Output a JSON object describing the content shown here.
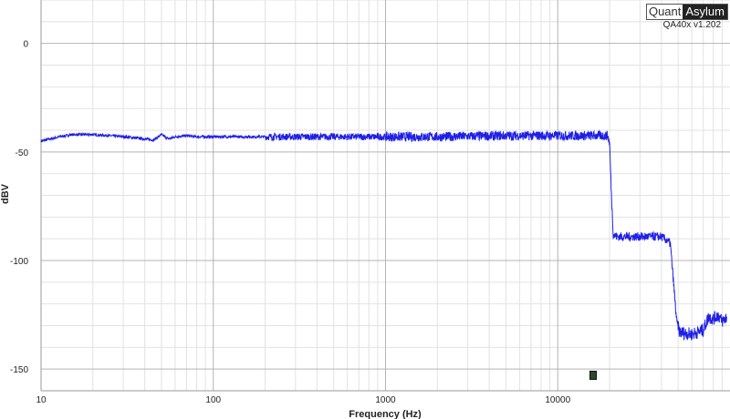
{
  "branding": {
    "logo_part1": "Quant",
    "logo_part2": "Asylum",
    "version": "QA40x v1.202"
  },
  "colors": {
    "trace": "#1f1fe6",
    "grid_major": "#b4b4b4",
    "grid_minor": "#e2e2e2",
    "marker": "#2b4a2b"
  },
  "chart_data": {
    "type": "line",
    "title": "",
    "xlabel": "Frequency (Hz)",
    "ylabel": "dBV",
    "x_scale": "log",
    "xlim": [
      10,
      100000
    ],
    "ylim": [
      -160,
      20
    ],
    "x_ticks": [
      10,
      100,
      1000,
      10000
    ],
    "x_tick_labels": [
      "10",
      "100",
      "1000",
      "10000"
    ],
    "y_ticks": [
      0,
      -50,
      -100,
      -150
    ],
    "y_tick_labels": [
      "0",
      "-50",
      "-100",
      "-150"
    ],
    "grid": true,
    "series": [
      {
        "points": [
          [
            10,
            -45
          ],
          [
            12,
            -43.5
          ],
          [
            15,
            -42
          ],
          [
            20,
            -42
          ],
          [
            25,
            -42.5
          ],
          [
            30,
            -43
          ],
          [
            35,
            -43.5
          ],
          [
            40,
            -44
          ],
          [
            45,
            -44.5
          ],
          [
            50,
            -42
          ],
          [
            55,
            -44
          ],
          [
            60,
            -43
          ],
          [
            70,
            -42.5
          ],
          [
            80,
            -43
          ],
          [
            100,
            -43
          ],
          [
            150,
            -43
          ],
          [
            200,
            -43
          ],
          [
            300,
            -43
          ],
          [
            500,
            -43
          ],
          [
            1000,
            -43
          ],
          [
            2000,
            -43
          ],
          [
            5000,
            -42.5
          ],
          [
            10000,
            -42.5
          ],
          [
            15000,
            -42.5
          ],
          [
            19500,
            -42.5
          ],
          [
            20000,
            -46
          ],
          [
            20500,
            -70
          ],
          [
            21000,
            -88
          ],
          [
            22000,
            -89
          ],
          [
            30000,
            -89
          ],
          [
            40000,
            -89
          ],
          [
            45000,
            -92
          ],
          [
            47000,
            -110
          ],
          [
            49000,
            -128
          ],
          [
            51000,
            -133
          ],
          [
            60000,
            -134
          ],
          [
            65000,
            -133
          ],
          [
            70000,
            -132
          ],
          [
            75000,
            -126
          ],
          [
            80000,
            -127
          ],
          [
            85000,
            -125
          ],
          [
            90000,
            -128
          ],
          [
            96000,
            -126
          ]
        ]
      }
    ]
  }
}
